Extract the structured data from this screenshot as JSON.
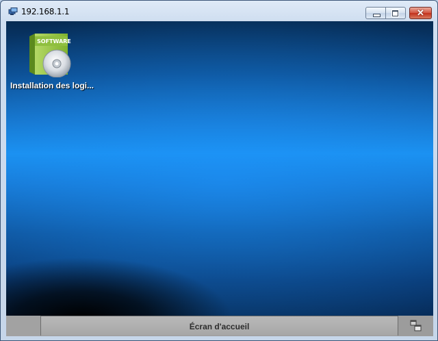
{
  "window": {
    "title": "192.168.1.1",
    "controls": {
      "minimize_icon": "minimize-icon",
      "maximize_icon": "maximize-icon",
      "close_glyph": "✕"
    }
  },
  "desktop": {
    "icons": [
      {
        "label": "Installation des logi...",
        "icon": "software-box-icon",
        "box_text": "SOFTWARE"
      }
    ],
    "colors": {
      "highlight": "#1a90ee",
      "deep": "#062a52"
    }
  },
  "taskbar": {
    "home_label": "Écran d'accueil",
    "switch_icon": "window-switch-icon"
  }
}
